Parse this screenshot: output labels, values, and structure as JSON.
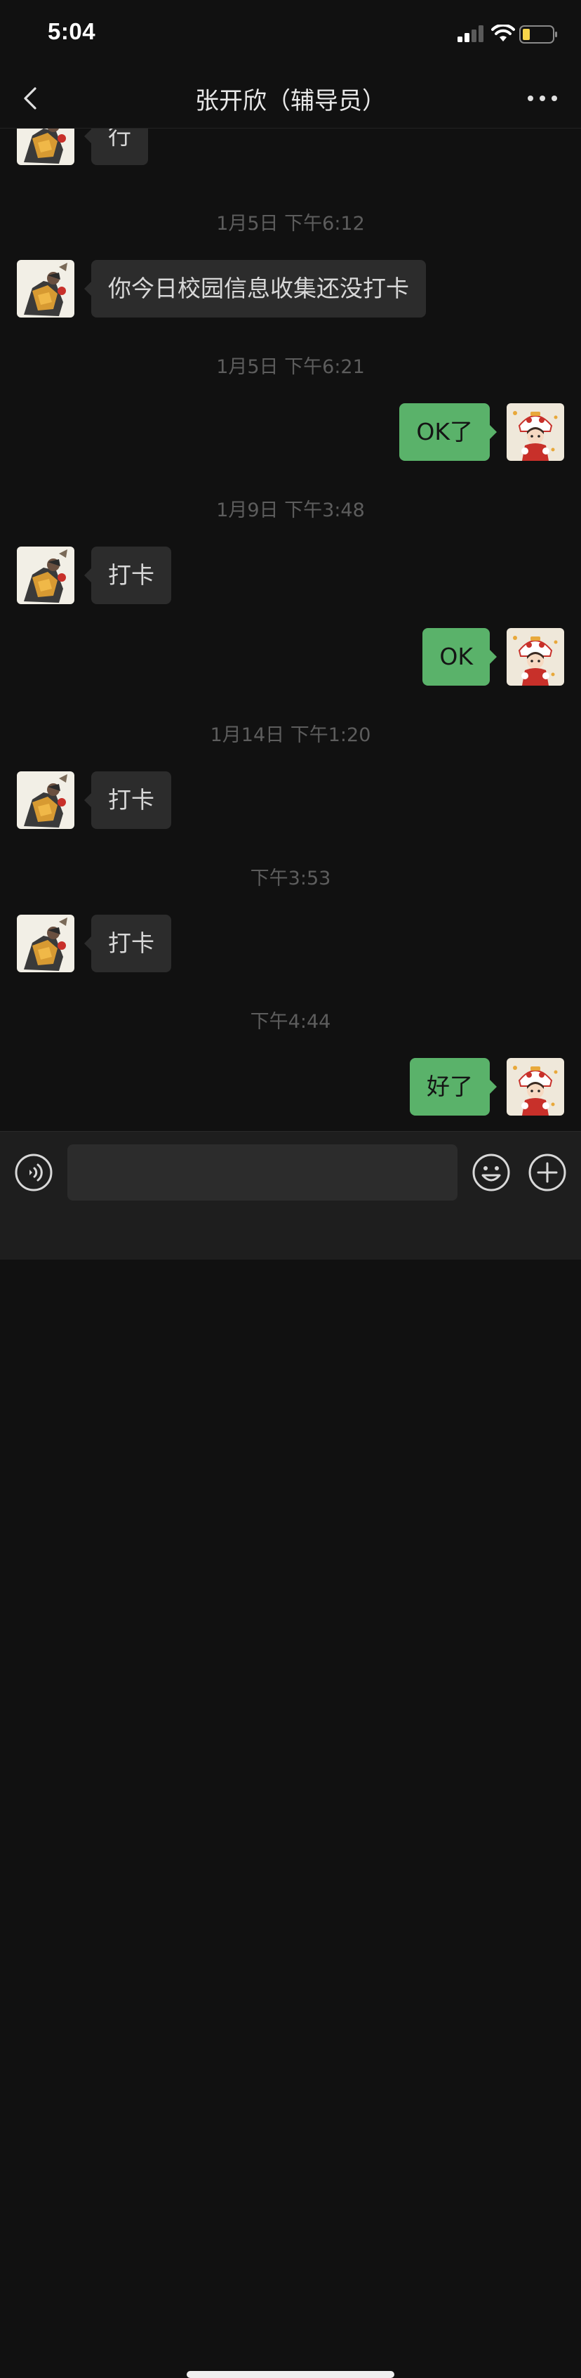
{
  "status_bar": {
    "time": "5:04"
  },
  "nav": {
    "title": "张开欣（辅导员）",
    "back_icon": "chevron-left-icon",
    "more_icon": "more-dots-icon"
  },
  "messages": [
    {
      "kind": "text",
      "side": "left",
      "text": "行"
    },
    {
      "kind": "time",
      "text": "1月5日 下午6:12"
    },
    {
      "kind": "text",
      "side": "left",
      "text": "你今日校园信息收集还没打卡"
    },
    {
      "kind": "time",
      "text": "1月5日 下午6:21"
    },
    {
      "kind": "text",
      "side": "right",
      "text": "OK了"
    },
    {
      "kind": "time",
      "text": "1月9日 下午3:48"
    },
    {
      "kind": "text",
      "side": "left",
      "text": "打卡"
    },
    {
      "kind": "text",
      "side": "right",
      "text": "OK"
    },
    {
      "kind": "time",
      "text": "1月14日 下午1:20"
    },
    {
      "kind": "text",
      "side": "left",
      "text": "打卡"
    },
    {
      "kind": "time",
      "text": "下午3:53"
    },
    {
      "kind": "text",
      "side": "left",
      "text": "打卡"
    },
    {
      "kind": "time",
      "text": "下午4:44"
    },
    {
      "kind": "text",
      "side": "right",
      "text": "好了"
    }
  ],
  "input_bar": {
    "placeholder": "",
    "value": "",
    "voice_icon": "voice-icon",
    "emoji_icon": "emoji-icon",
    "plus_icon": "plus-icon"
  },
  "colors": {
    "background": "#111111",
    "bubble_left": "#2c2c2c",
    "bubble_right": "#5ab26a",
    "timestamp": "#5d5d5d"
  }
}
